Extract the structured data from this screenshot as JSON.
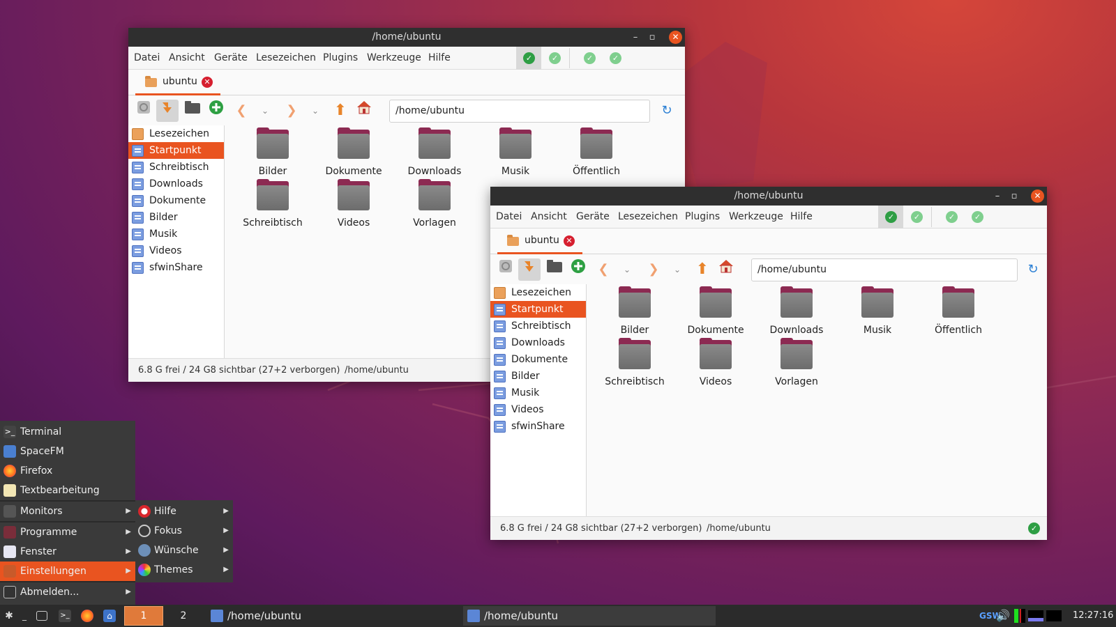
{
  "window_a": {
    "title": "/home/ubuntu",
    "menu": [
      "Datei",
      "Ansicht",
      "Geräte",
      "Lesezeichen",
      "Plugins",
      "Werkzeuge",
      "Hilfe"
    ],
    "tab_label": "ubuntu",
    "path": "/home/ubuntu",
    "sidebar": [
      "Lesezeichen",
      "Startpunkt",
      "Schreibtisch",
      "Downloads",
      "Dokumente",
      "Bilder",
      "Musik",
      "Videos",
      "sfwinShare"
    ],
    "selected_sidebar": "Startpunkt",
    "files": [
      "Bilder",
      "Dokumente",
      "Downloads",
      "Musik",
      "Öffentlich",
      "Schreibtisch",
      "Videos",
      "Vorlagen"
    ],
    "status_space": "6.8 G frei / 24 G8 sichtbar (27+2 verborgen)",
    "status_path": "/home/ubuntu"
  },
  "window_b": {
    "title": "/home/ubuntu",
    "menu": [
      "Datei",
      "Ansicht",
      "Geräte",
      "Lesezeichen",
      "Plugins",
      "Werkzeuge",
      "Hilfe"
    ],
    "tab_label": "ubuntu",
    "path": "/home/ubuntu",
    "sidebar": [
      "Lesezeichen",
      "Startpunkt",
      "Schreibtisch",
      "Downloads",
      "Dokumente",
      "Bilder",
      "Musik",
      "Videos",
      "sfwinShare"
    ],
    "selected_sidebar": "Startpunkt",
    "files": [
      "Bilder",
      "Dokumente",
      "Downloads",
      "Musik",
      "Öffentlich",
      "Schreibtisch",
      "Videos",
      "Vorlagen"
    ],
    "status_space": "6.8 G frei / 24 G8 sichtbar (27+2 verborgen)",
    "status_path": "/home/ubuntu"
  },
  "start_menu": {
    "items": [
      "Terminal",
      "SpaceFM",
      "Firefox",
      "Textbearbeitung",
      "Monitors",
      "Programme",
      "Fenster",
      "Einstellungen",
      "Abmelden..."
    ],
    "selected": "Einstellungen",
    "submenu": [
      "Hilfe",
      "Fokus",
      "Wünsche",
      "Themes"
    ]
  },
  "taskbar": {
    "workspace_1": "1",
    "workspace_2": "2",
    "tasks": [
      "/home/ubuntu",
      "/home/ubuntu"
    ],
    "tray_text": "GSW",
    "clock": "12:27:16"
  },
  "colors": {
    "accent": "#e95420",
    "titlebar": "#2f2f2f",
    "panel": "#2b2b2b",
    "check_green": "#2e9e44"
  }
}
